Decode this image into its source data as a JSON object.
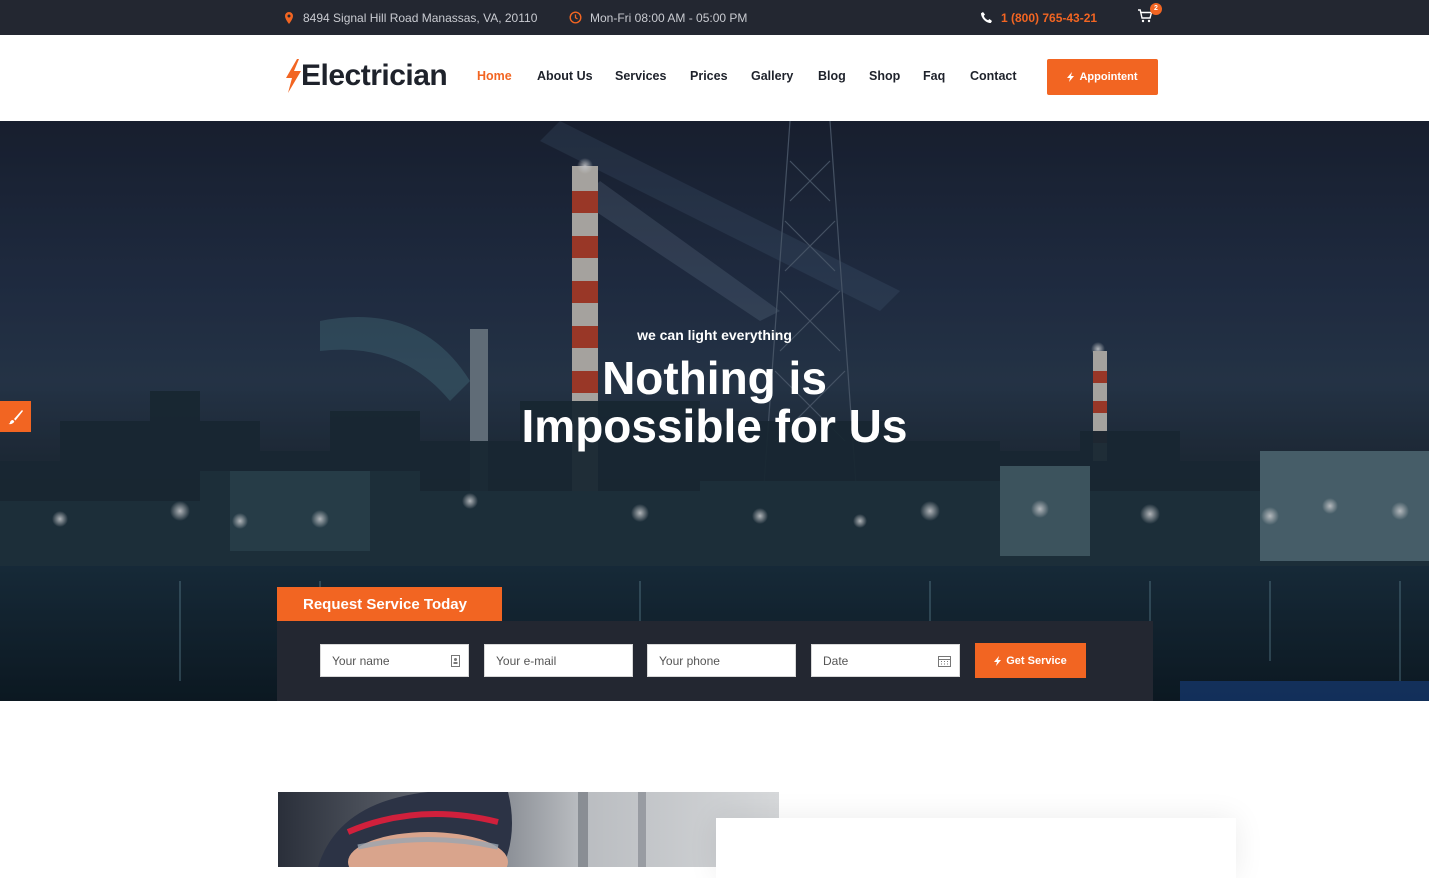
{
  "topbar": {
    "address": "8494 Signal Hill Road Manassas, VA, 20110",
    "hours": "Mon-Fri 08:00 AM - 05:00 PM",
    "phone": "1 (800) 765-43-21",
    "cart_count": "2",
    "icons": [
      "map-pin-icon",
      "clock-icon",
      "phone-icon",
      "cart-icon"
    ]
  },
  "header": {
    "logo_text": "Electrician",
    "nav": [
      "Home",
      "About Us",
      "Services",
      "Prices",
      "Gallery",
      "Blog",
      "Shop",
      "Faq",
      "Contact"
    ],
    "active_nav": "Home",
    "appointment_label": "Appointent"
  },
  "hero": {
    "kicker": "we can light everything",
    "title_line1": "Nothing is",
    "title_line2": "Impossible for Us"
  },
  "request": {
    "tab_title": "Request Service Today",
    "name_placeholder": "Your name",
    "email_placeholder": "Your e-mail",
    "phone_placeholder": "Your phone",
    "date_placeholder": "Date",
    "submit_label": "Get Service"
  },
  "colors": {
    "accent": "#f26522",
    "dark": "#232731",
    "text": "#1e222b"
  }
}
